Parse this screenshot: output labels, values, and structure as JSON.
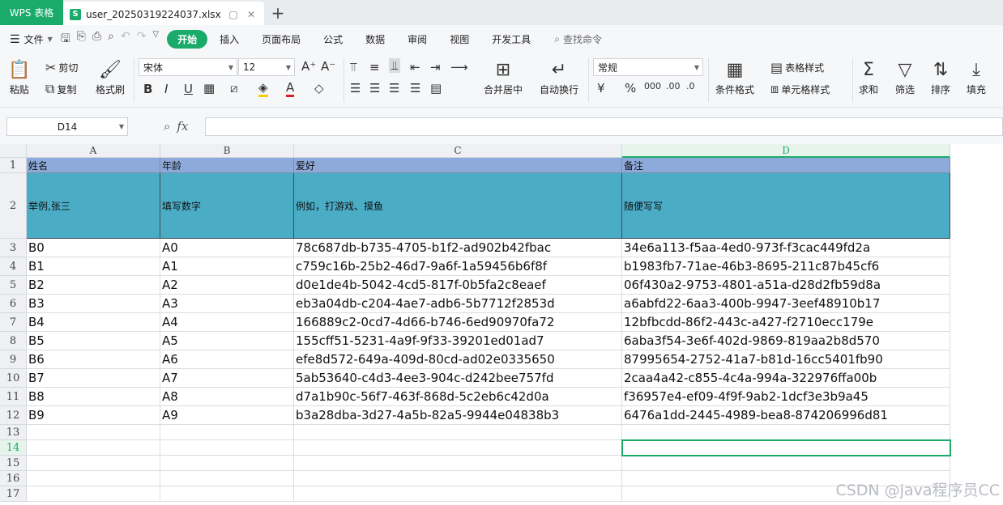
{
  "app_tab": "WPS 表格",
  "doc_tab": {
    "icon": "S",
    "name": "user_20250319224037.xlsx",
    "restore": "▢",
    "close": "✕"
  },
  "new_tab": "+",
  "menu": {
    "file_label": "文件",
    "tabs": [
      "开始",
      "插入",
      "页面布局",
      "公式",
      "数据",
      "审阅",
      "视图",
      "开发工具"
    ],
    "search_label": "查找命令"
  },
  "ribbon": {
    "paste": "粘贴",
    "cut": "剪切",
    "copy": "复制",
    "format_painter": "格式刷",
    "font_name": "宋体",
    "font_size": "12",
    "merge_center": "合并居中",
    "wrap_text": "自动换行",
    "number_format": "常规",
    "conditional_format": "条件格式",
    "table_style": "表格样式",
    "cell_style": "单元格样式",
    "sum": "求和",
    "filter": "筛选",
    "sort": "排序",
    "fill": "填充"
  },
  "formula_bar": {
    "name_box": "D14",
    "formula": ""
  },
  "columns": [
    "A",
    "B",
    "C",
    "D"
  ],
  "selected_column": "D",
  "selected_row": "14",
  "rows": [
    {
      "n": "1",
      "cells": [
        "姓名",
        "年龄",
        "爱好",
        "备注"
      ]
    },
    {
      "n": "2",
      "cells": [
        "举例,张三",
        "填写数字",
        "例如，打游戏、摸鱼",
        "随便写写"
      ]
    },
    {
      "n": "3",
      "cells": [
        "B0",
        "A0",
        "78c687db-b735-4705-b1f2-ad902b42fbac",
        "34e6a113-f5aa-4ed0-973f-f3cac449fd2a"
      ]
    },
    {
      "n": "4",
      "cells": [
        "B1",
        "A1",
        "c759c16b-25b2-46d7-9a6f-1a59456b6f8f",
        "b1983fb7-71ae-46b3-8695-211c87b45cf6"
      ]
    },
    {
      "n": "5",
      "cells": [
        "B2",
        "A2",
        "d0e1de4b-5042-4cd5-817f-0b5fa2c8eaef",
        "06f430a2-9753-4801-a51a-d28d2fb59d8a"
      ]
    },
    {
      "n": "6",
      "cells": [
        "B3",
        "A3",
        "eb3a04db-c204-4ae7-adb6-5b7712f2853d",
        "a6abfd22-6aa3-400b-9947-3eef48910b17"
      ]
    },
    {
      "n": "7",
      "cells": [
        "B4",
        "A4",
        "166889c2-0cd7-4d66-b746-6ed90970fa72",
        "12bfbcdd-86f2-443c-a427-f2710ecc179e"
      ]
    },
    {
      "n": "8",
      "cells": [
        "B5",
        "A5",
        "155cff51-5231-4a9f-9f33-39201ed01ad7",
        "6aba3f54-3e6f-402d-9869-819aa2b8d570"
      ]
    },
    {
      "n": "9",
      "cells": [
        "B6",
        "A6",
        "efe8d572-649a-409d-80cd-ad02e0335650",
        "87995654-2752-41a7-b81d-16cc5401fb90"
      ]
    },
    {
      "n": "10",
      "cells": [
        "B7",
        "A7",
        "5ab53640-c4d3-4ee3-904c-d242bee757fd",
        "2caa4a42-c855-4c4a-994a-322976ffa00b"
      ]
    },
    {
      "n": "11",
      "cells": [
        "B8",
        "A8",
        "d7a1b90c-56f7-463f-868d-5c2eb6c42d0a",
        "f36957e4-ef09-4f9f-9ab2-1dcf3e3b9a45"
      ]
    },
    {
      "n": "12",
      "cells": [
        "B9",
        "A9",
        "b3a28dba-3d27-4a5b-82a5-9944e04838b3",
        "6476a1dd-2445-4989-bea8-874206996d81"
      ]
    },
    {
      "n": "13",
      "cells": [
        "",
        "",
        "",
        ""
      ]
    },
    {
      "n": "14",
      "cells": [
        "",
        "",
        "",
        ""
      ]
    },
    {
      "n": "15",
      "cells": [
        "",
        "",
        "",
        ""
      ]
    },
    {
      "n": "16",
      "cells": [
        "",
        "",
        "",
        ""
      ]
    },
    {
      "n": "17",
      "cells": [
        "",
        "",
        "",
        ""
      ]
    }
  ],
  "watermark": "CSDN @java程序员CC",
  "colors": {
    "brand": "#1aab6b",
    "header_row1": "#8eaadb",
    "header_row2": "#4bacc6"
  }
}
